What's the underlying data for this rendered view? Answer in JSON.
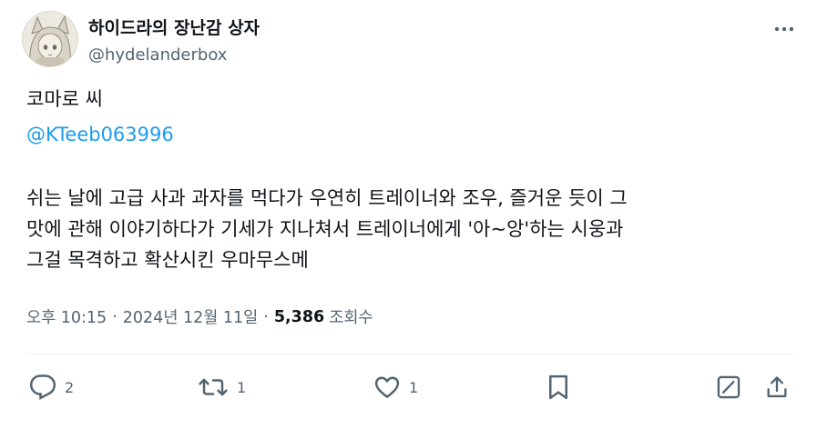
{
  "author": {
    "display_name": "하이드라의 장난감 상자",
    "handle": "@hydelanderbox",
    "avatar_icon": "anime-character-avatar"
  },
  "tweet": {
    "line1": "코마로 씨",
    "mention": "@KTeeb063996",
    "body": [
      "쉬는 날에 고급 사과 과자를 먹다가 우연히 트레이너와 조우, 즐거운 듯이 그",
      "맛에 관해 이야기하다가 기세가 지나쳐서 트레이너에게 '아~앙'하는 시웅과",
      "그걸 목격하고 확산시킨 우마무스메"
    ]
  },
  "meta": {
    "time": "오후 10:15",
    "dot1": "·",
    "date": "2024년 12월 11일",
    "dot2": "·",
    "views_count": "5,386",
    "views_label": "조회수"
  },
  "actions": {
    "reply": {
      "icon": "reply-icon",
      "count": "2"
    },
    "retweet": {
      "icon": "retweet-icon",
      "count": "1"
    },
    "like": {
      "icon": "heart-icon",
      "count": "1"
    },
    "bookmark": {
      "icon": "bookmark-icon"
    },
    "grok": {
      "icon": "grok-icon"
    },
    "share": {
      "icon": "share-icon"
    }
  },
  "colors": {
    "text": "#0f1419",
    "secondary": "#536471",
    "link": "#1d9bf0",
    "divider": "#eff3f4"
  }
}
